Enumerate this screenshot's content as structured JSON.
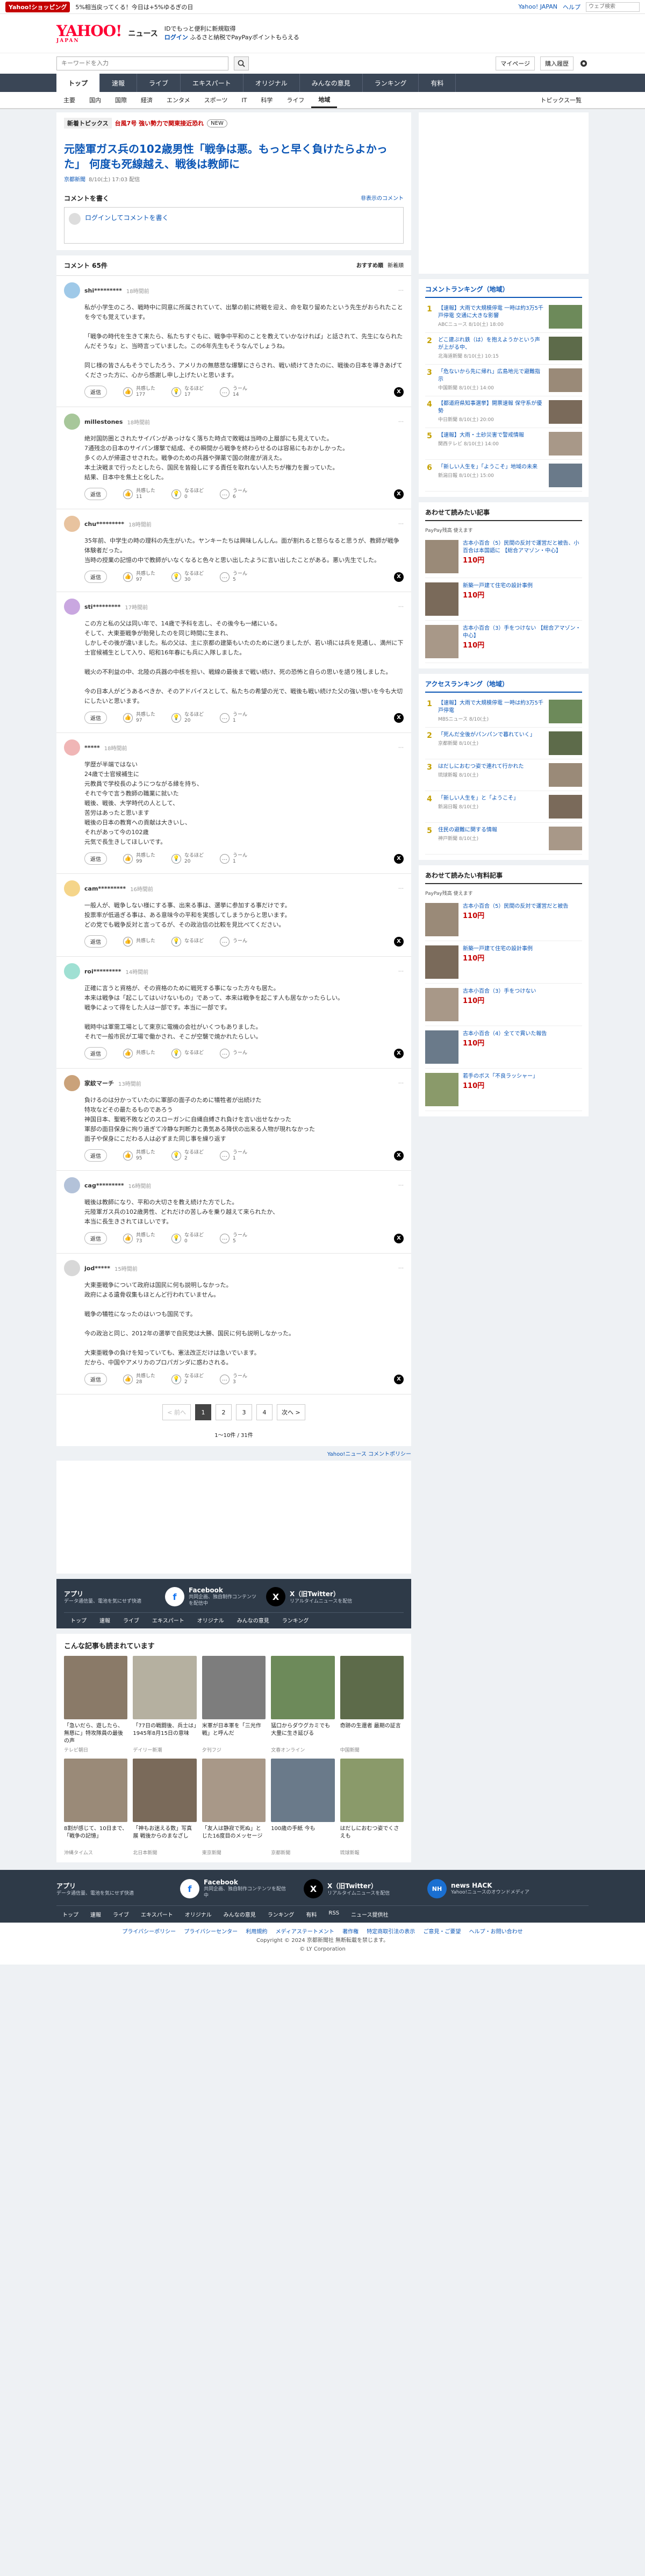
{
  "topbar": {
    "promo": "Yahoo!ショッピング",
    "promo_text": "5%相当戻ってくる！今日は+5%ゆるぎの日",
    "yj": "Yahoo! JAPAN",
    "help": "ヘルプ",
    "search_placeholder": "ウェブ検索"
  },
  "header": {
    "logo": "YAHOO!",
    "logo_sub": "JAPAN",
    "service": "ニュース",
    "line1": "IDでもっと便利に新規取得",
    "login": "ログイン",
    "line2": "ふるさと納税でPayPayポイントもらえる"
  },
  "search": {
    "placeholder": "キーワードを入力",
    "mypage": "マイページ",
    "buy": "購入履歴"
  },
  "nav": [
    "トップ",
    "速報",
    "ライブ",
    "エキスパート",
    "オリジナル",
    "みんなの意見",
    "ランキング",
    "有料"
  ],
  "subnav": [
    "主要",
    "国内",
    "国際",
    "経済",
    "エンタメ",
    "スポーツ",
    "IT",
    "科学",
    "ライフ",
    "地域"
  ],
  "subnav_right": "トピックス一覧",
  "topics": {
    "label": "新着トピックス",
    "red": "台風7号 強い勢力で関東接近恐れ",
    "star": "NEW"
  },
  "article": {
    "title": "元陸軍ガス兵の102歳男性「戦争は悪。もっと早く負けたらよかった」 何度も死線越え、戦後は教師に",
    "source": "京都新聞",
    "time": "8/10(土) 17:03 配信"
  },
  "comment_write": {
    "label": "コメントを書く",
    "link": "非表示のコメント",
    "login": "ログインしてコメントを書く"
  },
  "comments_head": {
    "count": "コメント 65件",
    "sort1": "おすすめ順",
    "sort2": "新着順"
  },
  "comments": [
    {
      "name": "shi*********",
      "time": "18時間前",
      "text": "私が小学生のころ、戦時中に同意に所属されていて、出撃の前に終戦を迎え、命を取り留めたという先生がおられたことを今でも覚えています。\n\n「戦争の時代を生きて来たら、私たちすぐもに、戦争中平和のことを教えていかなければ」と話されて、先生になられたんだそうな」と、当時言っていました。この6年先生もそうなんでしょうね。\n\n同じ様の皆さんもそうでしたろう、アメリカの無慈悲な爆撃にさらされ、戦い続けてきたのに、戦後の日本を導きあげてくださった方に、心から感謝し申し上げたいと思います。",
      "up": "177",
      "mid": "17",
      "down": "14"
    },
    {
      "name": "millestones",
      "time": "18時間前",
      "text": "絶対国防圏とされたサイパンがあっけなく落ちた時点で敗戦は当時の上層部にも見えていた。\n7通残念の日本のサイパン爆撃で結成、その瞬間から戦争を終わらせるのは容易にもおかしかった。\n多くの人が帰還させされた。戦争のための兵器や弾薬で国の財産が消えた。\n本土決戦まで行ったとしたら、国民を皆殺しにする責任を取れない人たちが権力を握っていた。\n結果、日本中を焦土と化した。",
      "up": "11",
      "mid": "0",
      "down": "6"
    },
    {
      "name": "chu*********",
      "time": "18時間前",
      "text": "35年前、中学生の時の理科の先生がいた。ヤンキーたちは興味しんしん。面が割れると怒らなると思うが、教師が戦争体験者だった。\n当時の授業の記憶の中で教師がいなくなると色々と思い出したように言い出したことがある。悪い先生でした。",
      "up": "97",
      "mid": "30",
      "down": "5"
    },
    {
      "name": "sti*********",
      "time": "17時間前",
      "text": "この方と私の父は同い年で、14歳で予科を志し、その後今も一緒にいる。\nそして、大東亜戦争が勃発したのを同じ時間に生まれ、\nしかしその後が違いました。私の父は、主に京都の建築もいたのために送りましたが、若い頃には兵を見通し、満州に下士官候補生として入り、昭和16年春にも兵に入隊しました。\n\n戦火の不利益の中、北陸の兵器の中核を担い、戦線の最後まで戦い続け、死の恐怖と自らの思いを語り残しました。\n\n今の日本人がどうあるべきか、そのアドバイスとして、私たちの希望の光で、戦後も戦い続けた父の強い想いを今も大切にしたいと思います。",
      "up": "97",
      "mid": "20",
      "down": "1"
    },
    {
      "name": "*****",
      "time": "18時間前",
      "text": "学歴が半端ではない\n24歳で士官候補生に\n元教員で学校長のようにつながる縁を持ち、\nそれで今で言う教師の職業に就いた\n戦後、戦後、大学時代の人として、\n苦労はあったと思います\n戦後の日本の教育への貢献は大きいし、\nそれがあって今の102歳\n元気で長生きしてほしいです。",
      "up": "99",
      "mid": "20",
      "down": "1"
    },
    {
      "name": "cam*********",
      "time": "16時間前",
      "text": "一般人が、戦争しない様にする事、出来る事は、選挙に参加する事だけです。\n投票率が低過ぎる事は、ある意味今の平和を実感してしまうからと思います。\nどの党でも戦争反対と言ってるが、その政治信の比較を見比べてください。",
      "up": "",
      "mid": "",
      "down": ""
    },
    {
      "name": "roi*********",
      "time": "14時間前",
      "text": "正確に言うと資格が、その資格のために戦死する事になった方々も居た。\n本来は戦争は「起こしてはいけないもの」であって、本来は戦争を起こす人も居なかったらしい。\n戦争によって得をした人は一部です。本当に一部です。\n\n戦時中は軍需工場として東京に電機の会社がいくつもありました。\nそれで一般市民が工場で働かされ、そこが空襲で焼かれたらしい。",
      "up": "",
      "mid": "",
      "down": ""
    },
    {
      "name": "家紋マーチ",
      "time": "13時間前",
      "text": "負けるのは分かっていたのに軍部の面子のために犠牲者が出続けた\n特攻などその最たるものであろう\n神国日本、聖戦不敗などのスローガンに自縄自縛され負けを言い出せなかった\n軍部の面目保身に拘り過ぎて冷静な判断力と勇気ある降伏の出来る人物が現れなかった\n面子や保身にこだわる人は必ずまた同じ事を繰り返す",
      "up": "95",
      "mid": "2",
      "down": "1"
    },
    {
      "name": "cag*********",
      "time": "16時間前",
      "text": "戦後は教師になり、平和の大切さを教え続けた方でした。\n元陸軍ガス兵の102歳男性、どれだけの苦しみを乗り越えて来られたか、\n本当に長生きされてほしいです。",
      "up": "73",
      "mid": "0",
      "down": "5"
    },
    {
      "name": "jod*****",
      "time": "15時間前",
      "text": "大東亜戦争について政府は国民に何も説明しなかった。\n政府による遺骨収集もほとんど行われていません。\n\n戦争の犠牲になったのはいつも国民です。\n\n今の政治と同じ、2012年の選挙で自民党は大勝、国民に何も説明しなかった。\n\n大東亜戦争の負けを知っていても、憲法改正だけは急いでいます。\nだから、中国やアメリカのプロパガンダに惑わされる。",
      "up": "28",
      "mid": "2",
      "down": "3"
    }
  ],
  "actions": {
    "reply": "返信",
    "up": "共感した",
    "mid": "なるほど",
    "down": "うーん"
  },
  "pager": {
    "prev": "< 前へ",
    "p1": "1",
    "p2": "2",
    "p3": "3",
    "p4": "4",
    "next": "次へ >",
    "count": "1〜10件 / 31件"
  },
  "policy": "Yahoo!ニュース コメントポリシー",
  "apps": {
    "app_title": "アプリ",
    "app_sub": "データ通信量、電池を気にせず快適",
    "fb": "Facebook",
    "fb_sub": "共同企画、独自制作コンテンツを配信中",
    "x": "X（旧Twitter）",
    "x_sub": "リアルタイムニュースを配信",
    "nav": [
      "トップ",
      "速報",
      "ライブ",
      "エキスパート",
      "オリジナル",
      "みんなの意見",
      "ランキング"
    ]
  },
  "recs": {
    "title": "こんな記事も読まれています",
    "items": [
      {
        "title": "「急いだら、遊したら、無慈に」特攻隊員の最後の声",
        "src": "テレビ朝日"
      },
      {
        "title": "「77日の戦闘後、兵士は」1945年8月15日の意味",
        "src": "デイリー新潮"
      },
      {
        "title": "米軍が日本軍を「三光作戦」と呼んだ",
        "src": "夕刊フジ"
      },
      {
        "title": "猛口からダウグカミでも大量に生き延びる",
        "src": "文春オンライン"
      },
      {
        "title": "奇跡の生還者 最期の証言",
        "src": "中国新聞"
      },
      {
        "title": "8割が感じて、10日まで、「戦争の記憶」",
        "src": "沖縄タイムス"
      },
      {
        "title": "「神もお迷える数」写真展 戦後からのまなざし",
        "src": "北日本新聞"
      },
      {
        "title": "「友人は静寂で死ぬ」とじた16度目のメッセージ",
        "src": "東京新聞"
      },
      {
        "title": "100歳の手紙 今も",
        "src": "京都新聞"
      },
      {
        "title": "はだしにおむつ姿でくさえも",
        "src": "琉球新報"
      }
    ]
  },
  "side": {
    "rank_title": "コメントランキング（地域）",
    "ranks": [
      {
        "n": "1",
        "t": "【速報】大雨で大規模停電 一時は約3万5千戸停電 交通に大きな影響",
        "s": "ABCニュース 8/10(土) 18:00"
      },
      {
        "n": "2",
        "t": "どこ建ぶれ鉄（は）を抱えようかという声が上がる中、",
        "s": "北海道新聞 8/10(土) 10:15"
      },
      {
        "n": "3",
        "t": "「危ないから先に帰れ」広島地元で避難指示",
        "s": "中国新聞 8/10(土) 14:00"
      },
      {
        "n": "4",
        "t": "【都道府県知事選挙】開票速報 保守系が優勢",
        "s": "中日新聞 8/10(土) 20:00"
      },
      {
        "n": "5",
        "t": "【速報】大雨・土砂災害で警戒情報",
        "s": "関西テレビ 8/10(土) 14:00"
      },
      {
        "n": "6",
        "t": "「新しい人生を」「ようこそ」地域の未来",
        "s": "新潟日報 8/10(土) 15:00"
      }
    ],
    "shop_title": "あわせて読みたい記事",
    "pay": "PayPay残高 使えます",
    "shops": [
      {
        "t": "古本小百合（5）民間の反対で運営だと被告、小百合は本国語に 【総合アマゾン・中心】",
        "p": "110円"
      },
      {
        "t": "新築一戸建て住宅の設計事例",
        "p": "110円"
      },
      {
        "t": "古本小百合（3）手をつけない 【総合アマゾン・中心】",
        "p": "110円"
      }
    ],
    "access_title": "アクセスランキング（地域）",
    "access": [
      {
        "n": "1",
        "t": "【速報】大雨で大規模停電 一時は約3万5千戸停電",
        "s": "MBSニュース 8/10(土)"
      },
      {
        "n": "2",
        "t": "「死んだ全後がパンパンで暮れていく」",
        "s": "京都新聞 8/10(土)"
      },
      {
        "n": "3",
        "t": "はだしにおむつ姿で連れて行かれた",
        "s": "琉球新報 8/10(土)"
      },
      {
        "n": "4",
        "t": "「新しい人生を」と「ようこそ」",
        "s": "新潟日報 8/10(土)"
      },
      {
        "n": "5",
        "t": "住民の避難に関する情報",
        "s": "神戸新聞 8/10(土)"
      }
    ],
    "shop2_title": "あわせて読みたい有料記事",
    "shops2": [
      {
        "t": "古本小百合（5）民間の反対で運営だと被告",
        "p": "110円"
      },
      {
        "t": "新築一戸建て住宅の設計事例",
        "p": "110円"
      },
      {
        "t": "古本小百合（3）手をつけない",
        "p": "110円"
      },
      {
        "t": "古本小百合（4）全てで貫いた報告",
        "p": "110円"
      },
      {
        "t": "若手のボス「不良ラッシャー」",
        "p": "110円"
      }
    ]
  },
  "footer": {
    "app_title": "アプリ",
    "app_sub": "データ通信量、電池を気にせず快適",
    "fb": "Facebook",
    "fb_sub": "共同企画、独自制作コンテンツを配信中",
    "x": "X（旧Twitter）",
    "x_sub": "リアルタイムニュースを配信",
    "hack": "news HACK",
    "hack_sub": "Yahoo!ニュースのオウンドメディア",
    "nav": [
      "トップ",
      "速報",
      "ライブ",
      "エキスパート",
      "オリジナル",
      "みんなの意見",
      "ランキング",
      "有料",
      "RSS",
      "ニュース提供社"
    ],
    "links": [
      "プライバシーポリシー",
      "プライバシーセンター",
      "利用規約",
      "メディアステートメント",
      "著作権",
      "特定商取引法の表示",
      "ご意見・ご要望",
      "ヘルプ・お問い合わせ"
    ],
    "copy": "Copyright © 2024 京都新聞社 無断転載を禁じます。",
    "copy2": "© LY Corporation"
  }
}
